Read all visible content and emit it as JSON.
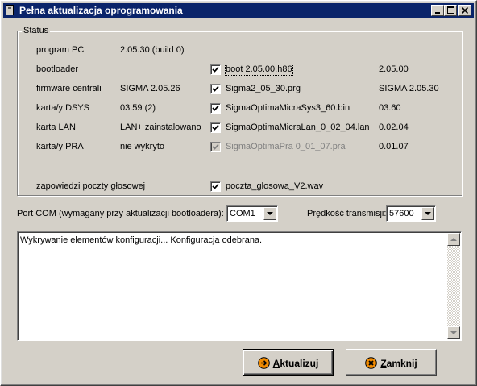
{
  "window": {
    "title": "Pełna aktualizacja oprogramowania",
    "controls": [
      "minimize",
      "maximize",
      "close"
    ]
  },
  "status": {
    "group_label": "Status",
    "rows": [
      {
        "name": "program PC",
        "current": "2.05.30   (build 0)",
        "has_file": false
      },
      {
        "name": "bootloader",
        "current": "",
        "has_file": true,
        "checked": true,
        "enabled": true,
        "focused": true,
        "file": "boot 2.05.00.h86",
        "new": "2.05.00"
      },
      {
        "name": "firmware centrali",
        "current": "SIGMA 2.05.26",
        "has_file": true,
        "checked": true,
        "enabled": true,
        "file": "Sigma2_05_30.prg",
        "new": "SIGMA 2.05.30"
      },
      {
        "name": "karta/y DSYS",
        "current": "03.59 (2)",
        "has_file": true,
        "checked": true,
        "enabled": true,
        "file": "SigmaOptimaMicraSys3_60.bin",
        "new": "03.60"
      },
      {
        "name": "karta LAN",
        "current": "LAN+ zainstalowano",
        "has_file": true,
        "checked": true,
        "enabled": true,
        "file": "SigmaOptimaMicraLan_0_02_04.lan",
        "new": "0.02.04"
      },
      {
        "name": "karta/y PRA",
        "current": "nie wykryto",
        "has_file": true,
        "checked": true,
        "enabled": false,
        "file": "SigmaOptimaPra 0_01_07.pra",
        "new": "0.01.07"
      }
    ],
    "voice": {
      "name": "zapowiedzi poczty głosowej",
      "checked": true,
      "file": "poczta_glosowa_V2.wav"
    }
  },
  "port": {
    "label": "Port COM (wymagany przy aktualizacji bootloadera):",
    "value": "COM1"
  },
  "speed": {
    "label": "Prędkość transmisji:",
    "value": "57600"
  },
  "log": {
    "text": "Wykrywanie elementów konfiguracji... Konfiguracja odebrana."
  },
  "buttons": {
    "update_prefix": "A",
    "update_rest": "ktualizuj",
    "close_prefix": "Z",
    "close_rest": "amknij"
  },
  "colors": {
    "titlebar": "#0a246a",
    "face": "#d4d0c8",
    "update_icon": "#f08a00",
    "close_icon": "#f08a00"
  },
  "icons": {
    "update": "arrow-right-circle-icon",
    "close": "x-circle-icon"
  }
}
